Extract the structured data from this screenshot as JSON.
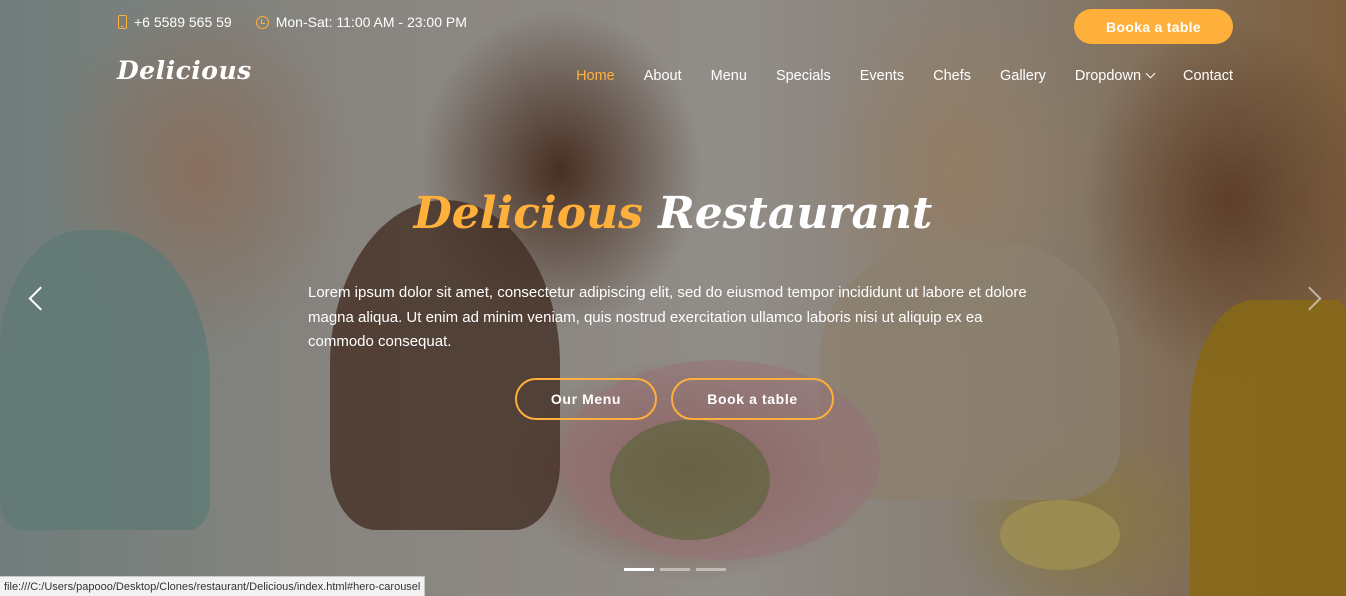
{
  "topbar": {
    "phone_icon": "phone-icon",
    "phone": "+6 5589 565 59",
    "clock_icon": "clock-icon",
    "hours": "Mon-Sat: 11:00 AM - 23:00 PM",
    "book_label": "Booka a table"
  },
  "header": {
    "logo": "Delicious",
    "nav": [
      {
        "label": "Home",
        "active": true
      },
      {
        "label": "About"
      },
      {
        "label": "Menu"
      },
      {
        "label": "Specials"
      },
      {
        "label": "Events"
      },
      {
        "label": "Chefs"
      },
      {
        "label": "Gallery"
      },
      {
        "label": "Dropdown",
        "has_dropdown": true
      },
      {
        "label": "Contact"
      }
    ]
  },
  "hero": {
    "title_accent": "Delicious",
    "title_rest": "Restaurant",
    "text": "Lorem ipsum dolor sit amet, consectetur adipiscing elit, sed do eiusmod tempor incididunt ut labore et dolore magna aliqua. Ut enim ad minim veniam, quis nostrud exercitation ullamco laboris nisi ut aliquip ex ea commodo consequat.",
    "btn_menu": "Our Menu",
    "btn_book": "Book a table",
    "slides_total": 3,
    "active_slide": 1
  },
  "status_bar": {
    "url": "file:///C:/Users/papooo/Desktop/Clones/restaurant/Delicious/index.html#hero-carousel"
  },
  "colors": {
    "accent": "#ffb03b",
    "text": "#ffffff"
  }
}
